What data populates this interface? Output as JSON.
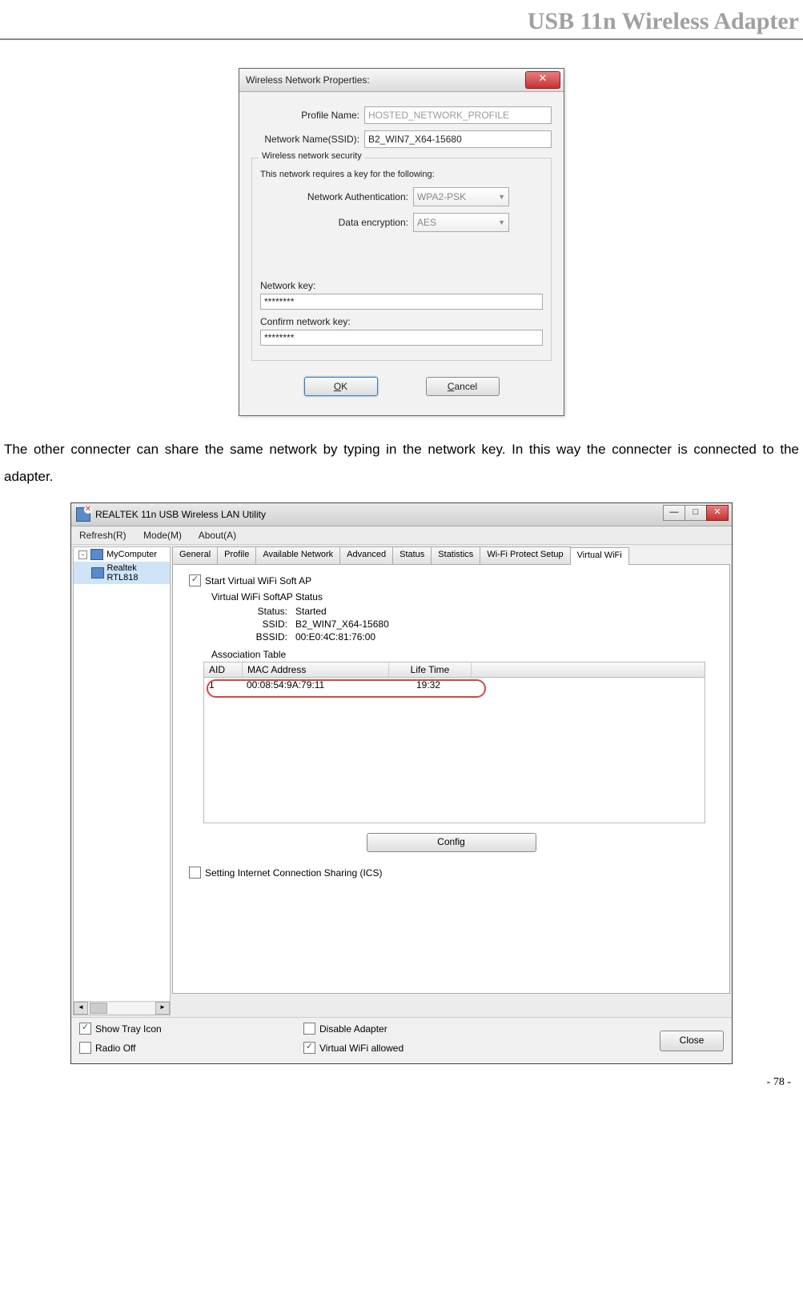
{
  "header": "USB 11n Wireless Adapter",
  "page_num": "- 78 -",
  "body_text": "The other connecter can share the same network by typing in the network key. In this way the connecter is connected to the adapter.",
  "dialog1": {
    "title": "Wireless Network Properties:",
    "profile_label": "Profile Name:",
    "profile_value": "HOSTED_NETWORK_PROFILE",
    "ssid_label": "Network Name(SSID):",
    "ssid_value": "B2_WIN7_X64-15680",
    "group_title": "Wireless network security",
    "group_sub": "This network requires a key for the following:",
    "auth_label": "Network Authentication:",
    "auth_value": "WPA2-PSK",
    "enc_label": "Data encryption:",
    "enc_value": "AES",
    "key_label": "Network key:",
    "key_value": "********",
    "confirm_label": "Confirm network key:",
    "confirm_value": "********",
    "ok_pre": "O",
    "ok_u": "K",
    "cancel_u": "C",
    "cancel_post": "ancel"
  },
  "dialog2": {
    "title": "REALTEK 11n USB Wireless LAN Utility",
    "menu": {
      "refresh": "Refresh(R)",
      "mode": "Mode(M)",
      "about": "About(A)"
    },
    "tree": {
      "root": "MyComputer",
      "child": "Realtek RTL818"
    },
    "tabs": [
      "General",
      "Profile",
      "Available Network",
      "Advanced",
      "Status",
      "Statistics",
      "Wi-Fi Protect Setup",
      "Virtual WiFi"
    ],
    "active_tab": "Virtual WiFi",
    "start_ap": "Start Virtual WiFi Soft AP",
    "softap_title": "Virtual WiFi SoftAP Status",
    "status_label": "Status:",
    "status_value": "Started",
    "ssid_label": "SSID:",
    "ssid_value": "B2_WIN7_X64-15680",
    "bssid_label": "BSSID:",
    "bssid_value": "00:E0:4C:81:76:00",
    "assoc_title": "Association Table",
    "cols": {
      "aid": "AID",
      "mac": "MAC Address",
      "life": "Life Time"
    },
    "rows": [
      {
        "aid": "1",
        "mac": "00:08:54:9A:79:11",
        "life": "19:32"
      }
    ],
    "config_btn": "Config",
    "ics": "Setting Internet Connection Sharing (ICS)",
    "bottom": {
      "show_tray": "Show Tray Icon",
      "radio_off": "Radio Off",
      "disable": "Disable Adapter",
      "vwifi": "Virtual WiFi allowed"
    },
    "close": "Close"
  }
}
